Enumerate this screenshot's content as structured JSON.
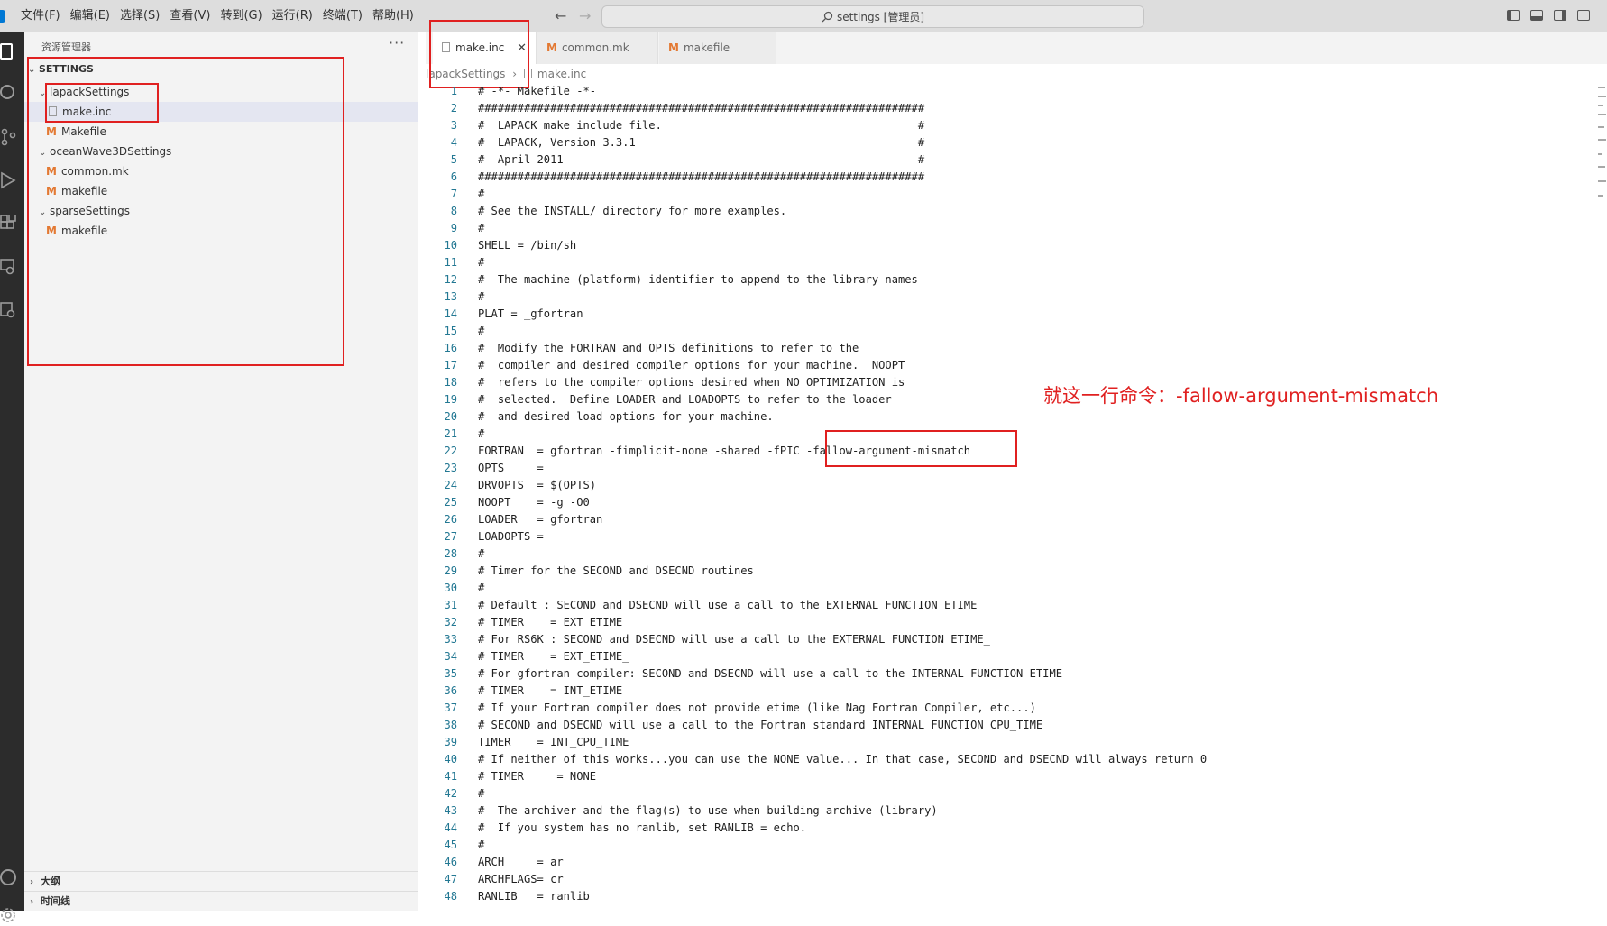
{
  "menubar": {
    "items": [
      "文件(F)",
      "编辑(E)",
      "选择(S)",
      "查看(V)",
      "转到(G)",
      "运行(R)",
      "终端(T)",
      "帮助(H)"
    ]
  },
  "title_search": {
    "text": "settings [管理员]"
  },
  "explorer": {
    "header": "资源管理器",
    "more": "···",
    "section": "SETTINGS",
    "tree": [
      {
        "label": "lapackSettings",
        "kind": "folder"
      },
      {
        "label": "make.inc",
        "kind": "file",
        "selected": true
      },
      {
        "label": "Makefile",
        "kind": "makefile"
      },
      {
        "label": "oceanWave3DSettings",
        "kind": "folder"
      },
      {
        "label": "common.mk",
        "kind": "makefile"
      },
      {
        "label": "makefile",
        "kind": "makefile"
      },
      {
        "label": "sparseSettings",
        "kind": "folder"
      },
      {
        "label": "makefile",
        "kind": "makefile"
      }
    ],
    "outline": "大纲",
    "timeline": "时间线"
  },
  "tabs": [
    {
      "label": "make.inc",
      "active": true
    },
    {
      "label": "common.mk",
      "active": false
    },
    {
      "label": "makefile",
      "active": false
    }
  ],
  "breadcrumb": {
    "folder": "lapackSettings",
    "file": "make.inc"
  },
  "code_lines": [
    "# -*- Makefile -*-",
    "####################################################################",
    "#  LAPACK make include file.                                       #",
    "#  LAPACK, Version 3.3.1                                           #",
    "#  April 2011                                                      #",
    "####################################################################",
    "#",
    "# See the INSTALL/ directory for more examples.",
    "#",
    "SHELL = /bin/sh",
    "#",
    "#  The machine (platform) identifier to append to the library names",
    "#",
    "PLAT = _gfortran",
    "#",
    "#  Modify the FORTRAN and OPTS definitions to refer to the",
    "#  compiler and desired compiler options for your machine.  NOOPT",
    "#  refers to the compiler options desired when NO OPTIMIZATION is",
    "#  selected.  Define LOADER and LOADOPTS to refer to the loader",
    "#  and desired load options for your machine.",
    "#",
    "FORTRAN  = gfortran -fimplicit-none -shared -fPIC -fallow-argument-mismatch",
    "OPTS     =",
    "DRVOPTS  = $(OPTS)",
    "NOOPT    = -g -O0",
    "LOADER   = gfortran",
    "LOADOPTS =",
    "#",
    "# Timer for the SECOND and DSECND routines",
    "#",
    "# Default : SECOND and DSECND will use a call to the EXTERNAL FUNCTION ETIME",
    "# TIMER    = EXT_ETIME",
    "# For RS6K : SECOND and DSECND will use a call to the EXTERNAL FUNCTION ETIME_",
    "# TIMER    = EXT_ETIME_",
    "# For gfortran compiler: SECOND and DSECND will use a call to the INTERNAL FUNCTION ETIME",
    "# TIMER    = INT_ETIME",
    "# If your Fortran compiler does not provide etime (like Nag Fortran Compiler, etc...)",
    "# SECOND and DSECND will use a call to the Fortran standard INTERNAL FUNCTION CPU_TIME",
    "TIMER    = INT_CPU_TIME",
    "# If neither of this works...you can use the NONE value... In that case, SECOND and DSECND will always return 0",
    "# TIMER     = NONE",
    "#",
    "#  The archiver and the flag(s) to use when building archive (library)",
    "#  If you system has no ranlib, set RANLIB = echo.",
    "#",
    "ARCH     = ar",
    "ARCHFLAGS= cr",
    "RANLIB   = ranlib"
  ],
  "annotation": {
    "text": "就这一行命令：-fallow-argument-mismatch"
  },
  "colors": {
    "accent": "#0078d4",
    "annotation": "#e02020",
    "makefile_icon": "#e37933",
    "line_number": "#237893"
  }
}
